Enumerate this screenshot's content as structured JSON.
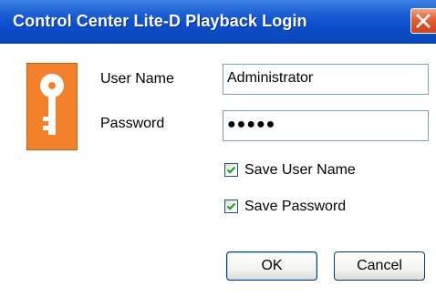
{
  "window": {
    "title": "Control Center Lite-D Playback Login",
    "close_icon": "close-icon"
  },
  "form": {
    "username_label": "User Name",
    "username_value": "Administrator",
    "password_label": "Password",
    "password_value": "●●●●●",
    "save_username_label": "Save User Name",
    "save_username_checked": true,
    "save_password_label": "Save Password",
    "save_password_checked": true
  },
  "buttons": {
    "ok_label": "OK",
    "cancel_label": "Cancel"
  },
  "icons": {
    "key": "key-icon"
  },
  "colors": {
    "titlebar": "#0b4dcb",
    "key_background": "#f3812c",
    "close_button": "#e0643c"
  }
}
